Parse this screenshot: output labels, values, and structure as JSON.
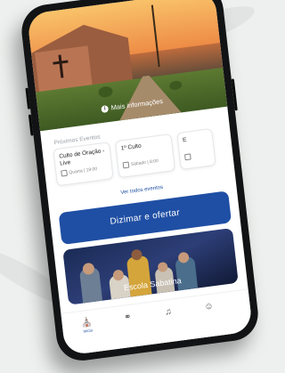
{
  "hero": {
    "more_info_label": "Mais informações"
  },
  "events": {
    "section_title": "Próximos Eventos",
    "items": [
      {
        "name": "Culto de Oração - Live",
        "meta": "Quarta | 19:00"
      },
      {
        "name": "1º Culto",
        "meta": "Sábado | 8:00"
      },
      {
        "name": "E",
        "meta": ""
      }
    ],
    "see_all_label": "Ver todos eventos"
  },
  "donate": {
    "label": "Dizimar e ofertar"
  },
  "school": {
    "title": "Escola Sabatina"
  },
  "tabbar": {
    "items": [
      {
        "icon": "church-icon",
        "label": "Início"
      },
      {
        "icon": "community-icon",
        "label": ""
      },
      {
        "icon": "music-icon",
        "label": ""
      },
      {
        "icon": "profile-icon",
        "label": ""
      }
    ]
  },
  "colors": {
    "primary": "#1f4fa4",
    "phone_body": "#121314"
  }
}
